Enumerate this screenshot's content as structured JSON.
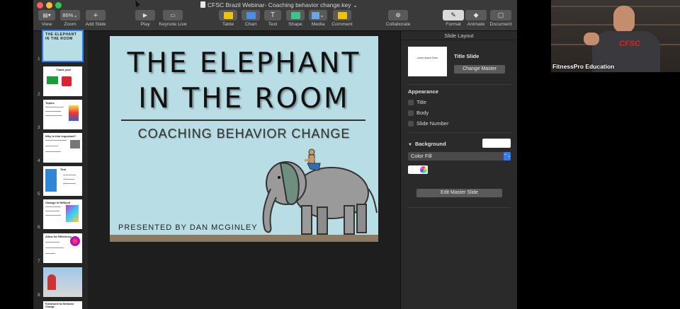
{
  "window": {
    "title": "CFSC Brazil Webinar- Coaching behavior change.key",
    "title_suffix": "⌄"
  },
  "toolbar": {
    "view_label": "View",
    "zoom_value": "86%",
    "zoom_label": "Zoom",
    "add_slide_label": "Add Slide",
    "play_label": "Play",
    "keynote_live_label": "Keynote Live",
    "table_label": "Table",
    "chart_label": "Chart",
    "text_label": "Text",
    "shape_label": "Shape",
    "media_label": "Media",
    "comment_label": "Comment",
    "collaborate_label": "Collaborate",
    "format_label": "Format",
    "animate_label": "Animate",
    "document_label": "Document"
  },
  "navigator": {
    "slides": [
      {
        "number": "1",
        "title": "THE ELEPHANT IN THE ROOM"
      },
      {
        "number": "2",
        "title": "Thank you!"
      },
      {
        "number": "3",
        "title": "Topics"
      },
      {
        "number": "4",
        "title": "Why is this important?"
      },
      {
        "number": "5",
        "title": "Tool"
      },
      {
        "number": "6",
        "title": "Change is Difficult"
      },
      {
        "number": "7",
        "title": "Allow for Efficiency"
      },
      {
        "number": "8",
        "title": ""
      },
      {
        "number": "",
        "title": "Framework for Behavior Change"
      }
    ]
  },
  "slide": {
    "title_line1": "THE ELEPHANT",
    "title_line2": "IN THE ROOM",
    "subtitle": "COACHING BEHAVIOR CHANGE",
    "presenter": "PRESENTED BY DAN MCGINLEY"
  },
  "panel": {
    "header": "Slide Layout",
    "master_thumb_text": "Lorem Ipsum Dolor",
    "master_name": "Title Slide",
    "change_master_label": "Change Master",
    "appearance_title": "Appearance",
    "appearance_options": [
      "Title",
      "Body",
      "Slide Number"
    ],
    "background_title": "Background",
    "fill_type": "Color Fill",
    "edit_master_label": "Edit Master Slide"
  },
  "webcam": {
    "label": "FitnessPro Education",
    "shirt_text": "CFSC"
  },
  "colors": {
    "slide_bg": "#b8dde4",
    "accent": "#2f7bf5",
    "toolbar": "#3a3a3a"
  }
}
